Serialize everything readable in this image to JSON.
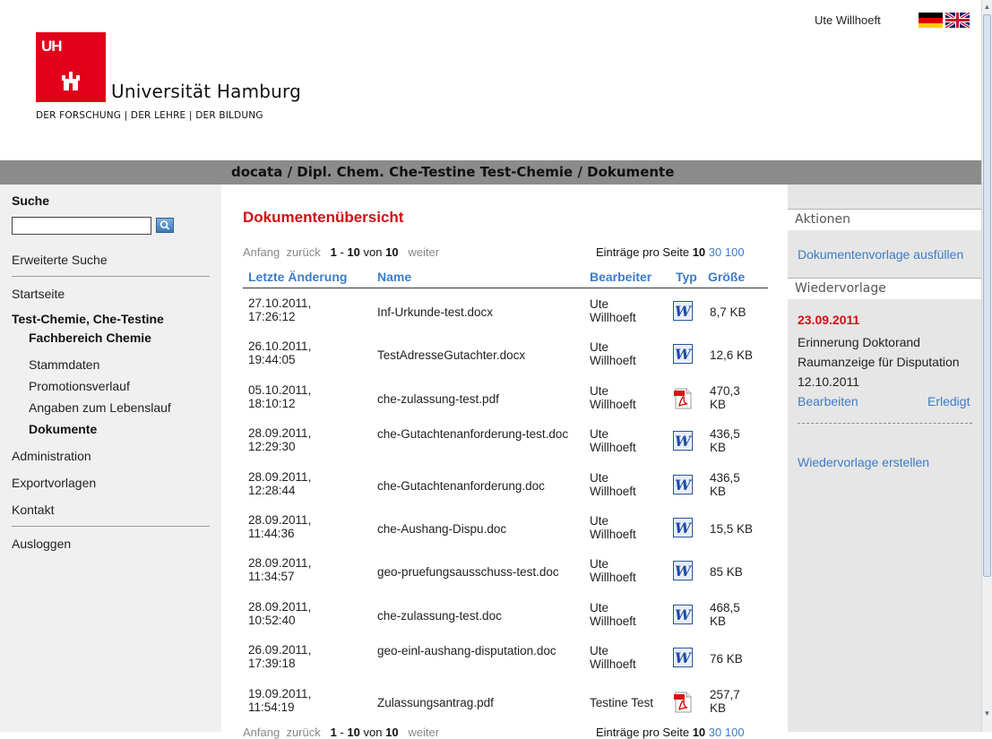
{
  "header": {
    "logo_mark": "UH",
    "university": "Universität Hamburg",
    "tagline": "DER FORSCHUNG | DER LEHRE | DER BILDUNG",
    "user": "Ute Willhoeft"
  },
  "breadcrumb": "docata / Dipl. Chem. Che-Testine Test-Chemie / Dokumente",
  "sidebar": {
    "search_label": "Suche",
    "search_value": "",
    "advanced_search": "Erweiterte Suche",
    "start": "Startseite",
    "person_name": "Test-Chemie, Che-Testine",
    "department": "Fachbereich Chemie",
    "sub_items": [
      "Stammdaten",
      "Promotionsverlauf",
      "Angaben zum Lebenslauf",
      "Dokumente"
    ],
    "administration": "Administration",
    "export": "Exportvorlagen",
    "contact": "Kontakt",
    "logout": "Ausloggen"
  },
  "main": {
    "title": "Dokumentenübersicht",
    "pager": {
      "first": "Anfang",
      "back": "zurück",
      "range_start": "1",
      "dash": "-",
      "range_end": "10",
      "of": "von",
      "total": "10",
      "next": "weiter",
      "per_page_label": "Einträge pro Seite",
      "per_page_current": "10",
      "per_page_opt1": "30",
      "per_page_opt2": "100"
    },
    "columns": [
      "Letzte Änderung",
      "Name",
      "Bearbeiter",
      "Typ",
      "Größe"
    ],
    "rows": [
      {
        "date": "27.10.2011,",
        "time": "17:26:12",
        "name": "Inf-Urkunde-test.docx",
        "editor1": "Ute",
        "editor2": "Willhoeft",
        "type": "word-icon",
        "size1": "8,7 KB",
        "size2": ""
      },
      {
        "date": "26.10.2011,",
        "time": "19:44:05",
        "name": "TestAdresseGutachter.docx",
        "editor1": "Ute",
        "editor2": "Willhoeft",
        "type": "word-icon",
        "size1": "12,6 KB",
        "size2": ""
      },
      {
        "date": "05.10.2011,",
        "time": "18:10:12",
        "name": "che-zulassung-test.pdf",
        "editor1": "Ute",
        "editor2": "Willhoeft",
        "type": "pdf-icon",
        "size1": "470,3",
        "size2": "KB"
      },
      {
        "date": "28.09.2011,",
        "time": "12:29:30",
        "name": "che-Gutachtenanforderung-test.doc",
        "editor1": "Ute",
        "editor2": "Willhoeft",
        "type": "word-icon",
        "size1": "436,5",
        "size2": "KB"
      },
      {
        "date": "28.09.2011,",
        "time": "12:28:44",
        "name": "che-Gutachtenanforderung.doc",
        "editor1": "Ute",
        "editor2": "Willhoeft",
        "type": "word-icon",
        "size1": "436,5",
        "size2": "KB"
      },
      {
        "date": "28.09.2011,",
        "time": "11:44:36",
        "name": "che-Aushang-Dispu.doc",
        "editor1": "Ute",
        "editor2": "Willhoeft",
        "type": "word-icon",
        "size1": "15,5 KB",
        "size2": ""
      },
      {
        "date": "28.09.2011,",
        "time": "11:34:57",
        "name": "geo-pruefungsausschuss-test.doc",
        "editor1": "Ute",
        "editor2": "Willhoeft",
        "type": "word-icon",
        "size1": "85 KB",
        "size2": ""
      },
      {
        "date": "28.09.2011,",
        "time": "10:52:40",
        "name": "che-zulassung-test.doc",
        "editor1": "Ute",
        "editor2": "Willhoeft",
        "type": "word-icon",
        "size1": "468,5",
        "size2": "KB"
      },
      {
        "date": "26.09.2011,",
        "time": "17:39:18",
        "name": "geo-einl-aushang-disputation.doc",
        "editor1": "Ute",
        "editor2": "Willhoeft",
        "type": "word-icon",
        "size1": "76 KB",
        "size2": ""
      },
      {
        "date": "19.09.2011,",
        "time": "11:54:19",
        "name": "Zulassungsantrag.pdf",
        "editor1": "Testine Test",
        "editor2": "",
        "type": "pdf-icon",
        "size1": "257,7",
        "size2": "KB"
      }
    ]
  },
  "right": {
    "actions_title": "Aktionen",
    "fill_template": "Dokumentenvorlage ausfüllen",
    "resubmission_title": "Wiedervorlage",
    "due_date": "23.09.2011",
    "reminder_line1": "Erinnerung Doktorand",
    "reminder_line2": "Raumanzeige für Disputation",
    "reminder_line3": "12.10.2011",
    "edit": "Bearbeiten",
    "done": "Erledigt",
    "create": "Wiedervorlage erstellen"
  },
  "colors": {
    "brand_red": "#e2001a",
    "title_red": "#d40d12",
    "link_blue": "#3d7cc9",
    "crumb_bar": "#8b8b8b"
  }
}
